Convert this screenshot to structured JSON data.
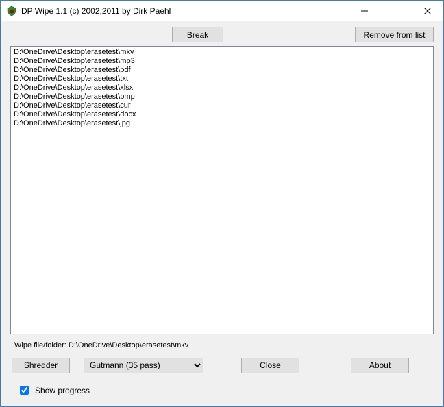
{
  "window": {
    "title": "DP Wipe 1.1 (c) 2002,2011 by Dirk Paehl"
  },
  "buttons": {
    "break": "Break",
    "remove": "Remove from list",
    "shredder": "Shredder",
    "close": "Close",
    "about": "About"
  },
  "list": {
    "items": [
      "D:\\OneDrive\\Desktop\\erasetest\\mkv",
      "D:\\OneDrive\\Desktop\\erasetest\\mp3",
      "D:\\OneDrive\\Desktop\\erasetest\\pdf",
      "D:\\OneDrive\\Desktop\\erasetest\\txt",
      "D:\\OneDrive\\Desktop\\erasetest\\xlsx",
      "D:\\OneDrive\\Desktop\\erasetest\\bmp",
      "D:\\OneDrive\\Desktop\\erasetest\\cur",
      "D:\\OneDrive\\Desktop\\erasetest\\docx",
      "D:\\OneDrive\\Desktop\\erasetest\\jpg"
    ]
  },
  "status": {
    "text": "Wipe file/folder: D:\\OneDrive\\Desktop\\erasetest\\mkv"
  },
  "method": {
    "selected": "Gutmann (35 pass)"
  },
  "checkbox": {
    "show_progress_label": "Show progress",
    "show_progress_checked": true
  }
}
